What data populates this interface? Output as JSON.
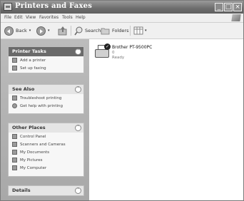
{
  "window": {
    "title": "Printers and Faxes"
  },
  "menu": [
    "File",
    "Edit",
    "View",
    "Favorites",
    "Tools",
    "Help"
  ],
  "toolbar": {
    "back": "Back",
    "search": "Search",
    "folders": "Folders"
  },
  "panels": {
    "printer_tasks": {
      "title": "Printer Tasks",
      "items": [
        "Add a printer",
        "Set up faxing"
      ]
    },
    "see_also": {
      "title": "See Also",
      "items": [
        "Troubleshoot printing",
        "Get help with printing"
      ]
    },
    "other_places": {
      "title": "Other Places",
      "items": [
        "Control Panel",
        "Scanners and Cameras",
        "My Documents",
        "My Pictures",
        "My Computer"
      ]
    },
    "details": {
      "title": "Details"
    }
  },
  "printer": {
    "name": "Brother PT-9500PC",
    "documents": "0",
    "status": "Ready"
  }
}
